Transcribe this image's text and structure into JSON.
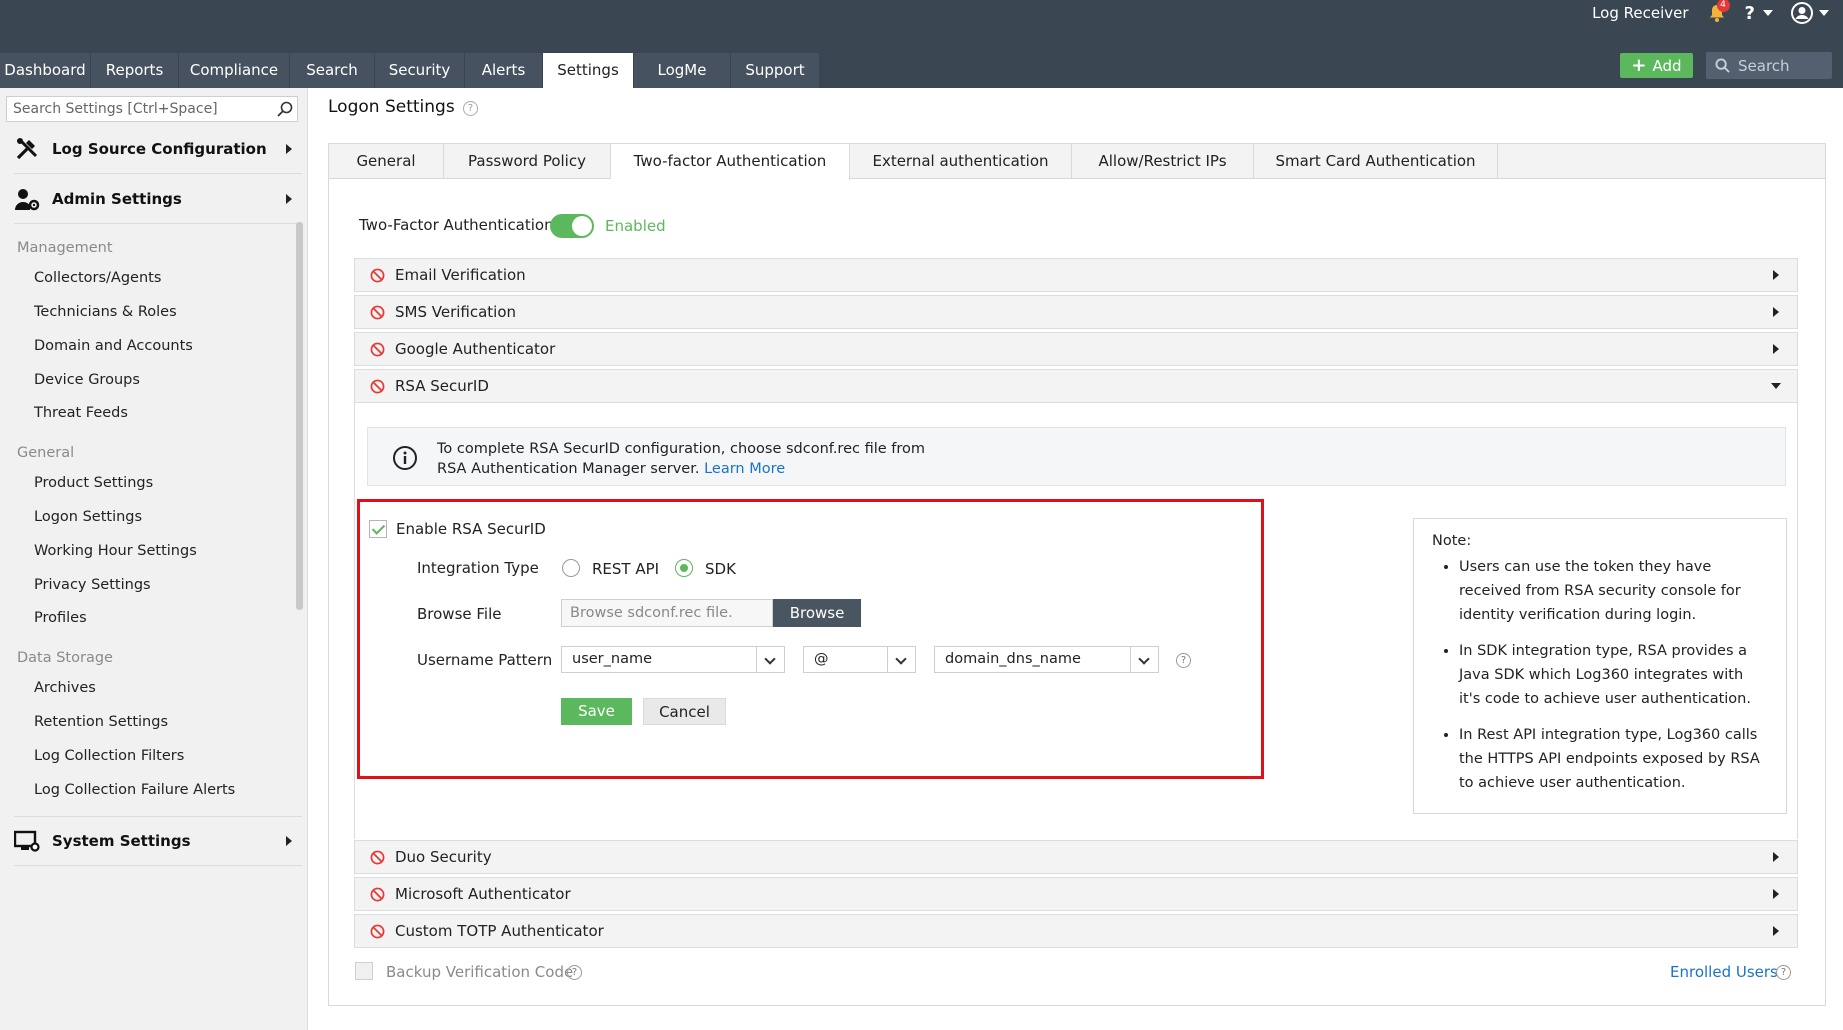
{
  "header": {
    "app_title": "Log Receiver",
    "notification_count": "4",
    "help_label": "?",
    "add_label": "Add",
    "search_placeholder": "Search"
  },
  "nav": {
    "tabs": [
      {
        "label": "Dashboard"
      },
      {
        "label": "Reports"
      },
      {
        "label": "Compliance"
      },
      {
        "label": "Search"
      },
      {
        "label": "Security"
      },
      {
        "label": "Alerts"
      },
      {
        "label": "Settings",
        "active": true
      },
      {
        "label": "LogMe"
      },
      {
        "label": "Support"
      }
    ]
  },
  "sidebar": {
    "search_placeholder": "Search Settings [Ctrl+Space]",
    "sections": [
      {
        "label": "Log Source Configuration",
        "icon": "tools-icon"
      },
      {
        "label": "Admin Settings",
        "icon": "admin-user-gear-icon"
      },
      {
        "label": "System Settings",
        "icon": "monitor-gear-icon"
      }
    ],
    "groups": [
      {
        "label": "Management",
        "items": [
          "Collectors/Agents",
          "Technicians & Roles",
          "Domain and Accounts",
          "Device Groups",
          "Threat Feeds"
        ]
      },
      {
        "label": "General",
        "items": [
          "Product Settings",
          "Logon Settings",
          "Working Hour Settings",
          "Privacy Settings",
          "Profiles"
        ]
      },
      {
        "label": "Data Storage",
        "items": [
          "Archives",
          "Retention Settings",
          "Log Collection Filters",
          "Log Collection Failure Alerts"
        ]
      }
    ]
  },
  "main": {
    "page_title": "Logon Settings",
    "tabs": [
      {
        "label": "General"
      },
      {
        "label": "Password Policy"
      },
      {
        "label": "Two-factor Authentication",
        "active": true
      },
      {
        "label": "External authentication"
      },
      {
        "label": "Allow/Restrict IPs"
      },
      {
        "label": "Smart Card Authentication"
      }
    ],
    "tfa_label": "Two-Factor Authentication",
    "tfa_status": "Enabled",
    "accordion": [
      {
        "label": "Email Verification",
        "expanded": false
      },
      {
        "label": "SMS Verification",
        "expanded": false
      },
      {
        "label": "Google Authenticator",
        "expanded": false
      },
      {
        "label": "RSA SecurID",
        "expanded": true
      },
      {
        "label": "Duo Security",
        "expanded": false
      },
      {
        "label": "Microsoft Authenticator",
        "expanded": false
      },
      {
        "label": "Custom TOTP Authenticator",
        "expanded": false
      }
    ],
    "rsa": {
      "info_line1": "To complete RSA SecurID configuration, choose sdconf.rec file from",
      "info_line2": "RSA Authentication Manager server.",
      "learn_more": "Learn More",
      "enable_label": "Enable RSA SecurID",
      "integration_label": "Integration Type",
      "option_rest": "REST API",
      "option_sdk": "SDK",
      "selected_option": "SDK",
      "browse_label": "Browse File",
      "file_placeholder": "Browse sdconf.rec file.",
      "browse_button": "Browse",
      "username_label": "Username Pattern",
      "pattern_user": "user_name",
      "pattern_sep": "@",
      "pattern_domain": "domain_dns_name",
      "save_button": "Save",
      "cancel_button": "Cancel"
    },
    "note": {
      "title": "Note:",
      "items": [
        "Users can use the token they have received from RSA security console for identity verification during login.",
        "In SDK integration type, RSA provides a Java SDK which Log360 integrates with it's code to achieve user authentication.",
        "In Rest API integration type, Log360 calls the HTTPS API endpoints exposed by RSA to achieve user authentication."
      ]
    },
    "backup_label": "Backup Verification Code",
    "enrolled_label": "Enrolled Users"
  },
  "colors": {
    "header_bg": "#3b4653",
    "accent_green": "#5cb85c",
    "highlight_red": "#e0101b",
    "link_blue": "#1a73c8"
  }
}
